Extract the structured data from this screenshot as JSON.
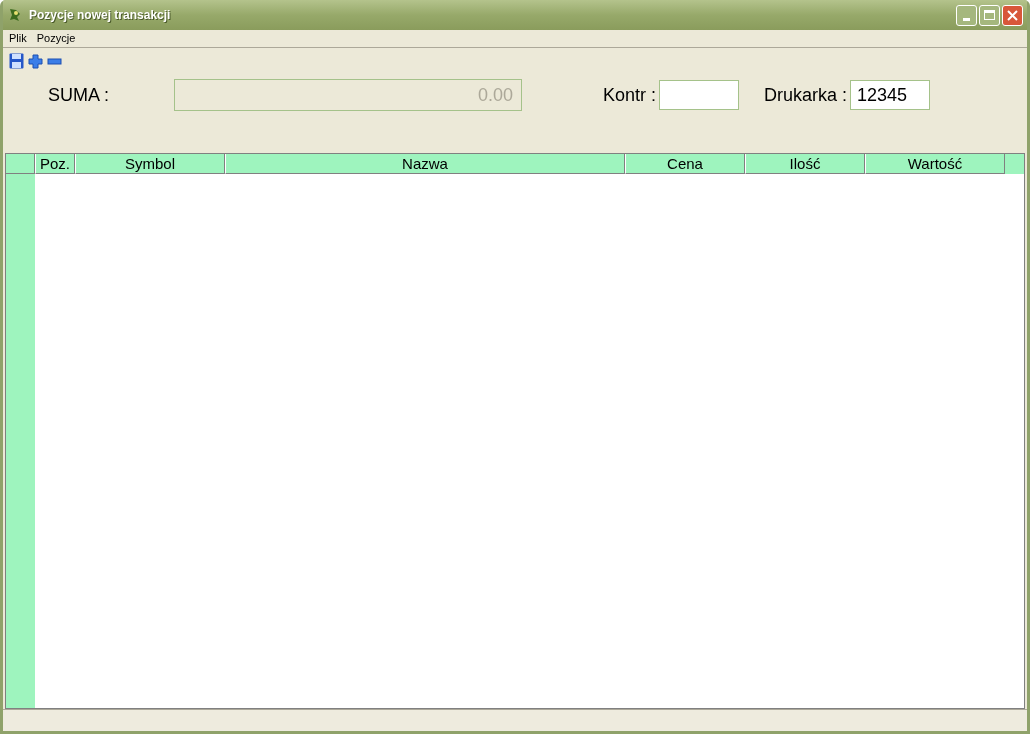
{
  "window": {
    "title": "Pozycje nowej transakcji"
  },
  "menu": [
    "Plik",
    "Pozycje"
  ],
  "form": {
    "sum": {
      "label": "SUMA :",
      "value": "0.00",
      "disabled": true
    },
    "contractor": {
      "label": "Kontr :"
    },
    "printer": {
      "label": "Drukarka :",
      "value": "12345"
    }
  },
  "table": {
    "columns": [
      "Poz.",
      "Symbol",
      "Nazwa",
      "Cena",
      "Ilość",
      "Wartość"
    ]
  }
}
